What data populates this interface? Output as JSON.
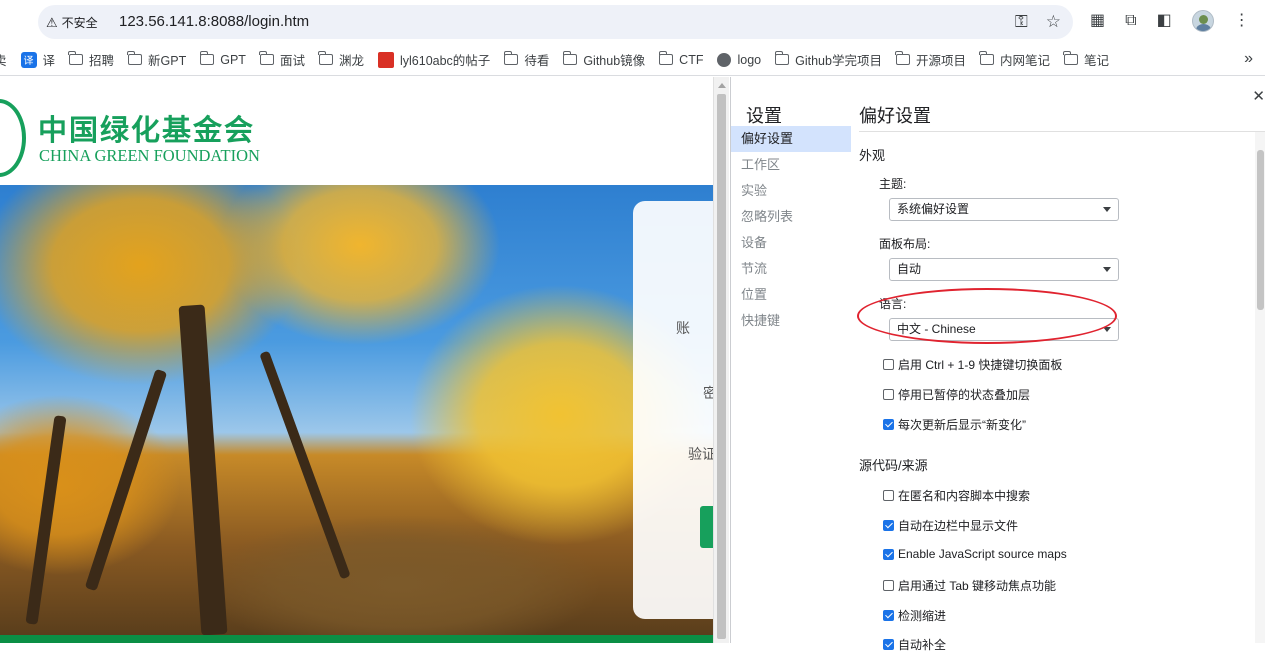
{
  "address_bar": {
    "security_label": "不安全",
    "url": "123.56.141.8:8088/login.htm"
  },
  "bookmarks": {
    "items": [
      {
        "label": "译",
        "icon": "translate-icon"
      },
      {
        "label": "招聘",
        "icon": "folder-icon"
      },
      {
        "label": "新GPT",
        "icon": "folder-icon"
      },
      {
        "label": "GPT",
        "icon": "folder-icon"
      },
      {
        "label": "面试",
        "icon": "folder-icon"
      },
      {
        "label": "渊龙",
        "icon": "folder-icon"
      },
      {
        "label": "lyl610abc的帖子",
        "icon": "red-favicon-icon"
      },
      {
        "label": "待看",
        "icon": "folder-icon"
      },
      {
        "label": "Github镜像",
        "icon": "folder-icon"
      },
      {
        "label": "CTF",
        "icon": "folder-icon"
      },
      {
        "label": "logo",
        "icon": "globe-icon"
      },
      {
        "label": "Github学完项目",
        "icon": "folder-icon"
      },
      {
        "label": "开源项目",
        "icon": "folder-icon"
      },
      {
        "label": "内网笔记",
        "icon": "folder-icon"
      },
      {
        "label": "笔记",
        "icon": "folder-icon"
      }
    ],
    "partial_first": "卖"
  },
  "website": {
    "logo_cn": "中国绿化基金会",
    "logo_en": "CHINA GREEN FOUNDATION",
    "form_labels": [
      "账",
      "密",
      "验证"
    ]
  },
  "devtools": {
    "title": "设置",
    "nav": [
      "偏好设置",
      "工作区",
      "实验",
      "忽略列表",
      "设备",
      "节流",
      "位置",
      "快捷键"
    ],
    "active_nav": "偏好设置",
    "panel_title": "偏好设置",
    "appearance": {
      "heading": "外观",
      "theme_label": "主题:",
      "theme_value": "系统偏好设置",
      "layout_label": "面板布局:",
      "layout_value": "自动",
      "language_label": "语言:",
      "language_value": "中文 - Chinese",
      "checkboxes": [
        {
          "label": "启用 Ctrl + 1-9 快捷键切换面板",
          "checked": false
        },
        {
          "label": "停用已暂停的状态叠加层",
          "checked": false
        },
        {
          "label": "每次更新后显示“新变化”",
          "checked": true
        }
      ]
    },
    "sources": {
      "heading": "源代码/来源",
      "checkboxes": [
        {
          "label": "在匿名和内容脚本中搜索",
          "checked": false
        },
        {
          "label": "自动在边栏中显示文件",
          "checked": true
        },
        {
          "label": "Enable JavaScript source maps",
          "checked": true
        },
        {
          "label": "启用通过 Tab 键移动焦点功能",
          "checked": false
        },
        {
          "label": "检测缩进",
          "checked": true
        },
        {
          "label": "自动补全",
          "checked": true
        }
      ]
    },
    "highlight_color": "#e0232f"
  }
}
